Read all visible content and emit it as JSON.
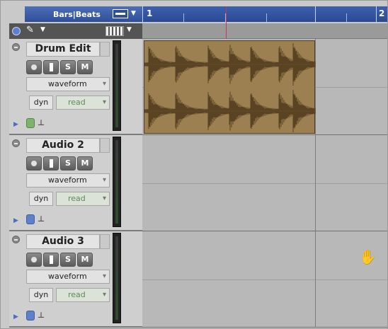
{
  "window": {
    "ruler_label": "Bars|Beats",
    "bar_markers": [
      "1",
      "2"
    ]
  },
  "toolbar": {
    "tool_icon": "pencil-icon"
  },
  "tracks": [
    {
      "name": "Drum Edit",
      "buttons": {
        "record": "record",
        "input": "I",
        "solo": "S",
        "mute": "M"
      },
      "view_mode": "waveform",
      "dyn_label": "dyn",
      "automation": "read",
      "input_icon_color": "#7fb26b"
    },
    {
      "name": "Audio 2",
      "buttons": {
        "record": "record",
        "input": "I",
        "solo": "S",
        "mute": "M"
      },
      "view_mode": "waveform",
      "dyn_label": "dyn",
      "automation": "read",
      "input_icon_color": "#5f7fc9"
    },
    {
      "name": "Audio 3",
      "buttons": {
        "record": "record",
        "input": "I",
        "solo": "S",
        "mute": "M"
      },
      "view_mode": "waveform",
      "dyn_label": "dyn",
      "automation": "read",
      "input_icon_color": "#5f7fc9"
    }
  ],
  "colors": {
    "ruler_bg": "#2e4f98",
    "clip_bg": "#9c8052",
    "waveform": "#5a4322",
    "cursor_line": "#c23a5a"
  }
}
